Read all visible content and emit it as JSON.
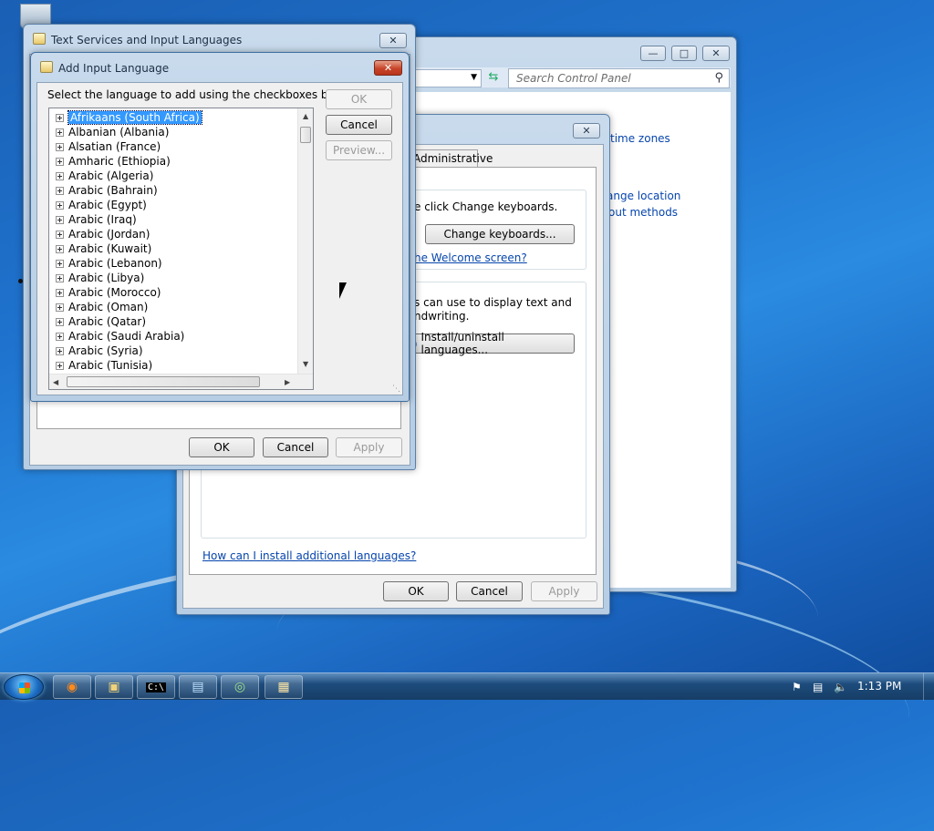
{
  "desktop": {
    "recycle_icon": "recycle-bin-icon"
  },
  "control_panel": {
    "search_placeholder": "Search Control Panel",
    "links": [
      "time zones",
      "ange location",
      "out methods"
    ]
  },
  "region_dialog": {
    "tab_admin": "Administrative",
    "keyboards_text": "e click Change keyboards.",
    "change_keyboards": "Change keyboards...",
    "welcome_link": "he Welcome screen?",
    "display_text_1": "s can use to display text and",
    "display_text_2": "ndwriting.",
    "install_uninstall": "Install/uninstall languages...",
    "install_link": "How can I install additional languages?",
    "ok": "OK",
    "cancel": "Cancel",
    "apply": "Apply"
  },
  "text_services": {
    "title": "Text Services and Input Languages",
    "ok": "OK",
    "cancel": "Cancel",
    "apply": "Apply"
  },
  "add_input": {
    "title": "Add Input Language",
    "instruction": "Select the language to add using the checkboxes below.",
    "ok": "OK",
    "cancel": "Cancel",
    "preview": "Preview...",
    "languages": [
      "Afrikaans (South Africa)",
      "Albanian (Albania)",
      "Alsatian (France)",
      "Amharic (Ethiopia)",
      "Arabic (Algeria)",
      "Arabic (Bahrain)",
      "Arabic (Egypt)",
      "Arabic (Iraq)",
      "Arabic (Jordan)",
      "Arabic (Kuwait)",
      "Arabic (Lebanon)",
      "Arabic (Libya)",
      "Arabic (Morocco)",
      "Arabic (Oman)",
      "Arabic (Qatar)",
      "Arabic (Saudi Arabia)",
      "Arabic (Syria)",
      "Arabic (Tunisia)"
    ],
    "selected_index": 0
  },
  "taskbar": {
    "clock": "1:13 PM",
    "apps": [
      "firefox-icon",
      "explorer-icon",
      "cmd-icon",
      "remote-desktop-icon",
      "network-icon",
      "control-panel-icon"
    ]
  }
}
